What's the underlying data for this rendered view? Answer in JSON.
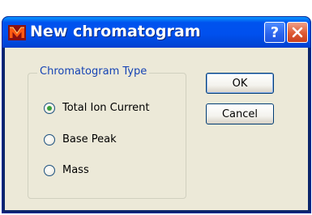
{
  "window": {
    "title": "New chromatogram"
  },
  "titlebar_buttons": {
    "help": "?",
    "close_icon": "close-x-icon"
  },
  "group": {
    "label": "Chromatogram Type",
    "options": [
      {
        "label": "Total Ion Current",
        "selected": true
      },
      {
        "label": "Base Peak",
        "selected": false
      },
      {
        "label": "Mass",
        "selected": false
      }
    ]
  },
  "buttons": {
    "ok": "OK",
    "cancel": "Cancel"
  },
  "colors": {
    "titlebar": "#0053ee",
    "client": "#ece9d8",
    "group_label": "#1644b4",
    "close": "#de5a32"
  }
}
